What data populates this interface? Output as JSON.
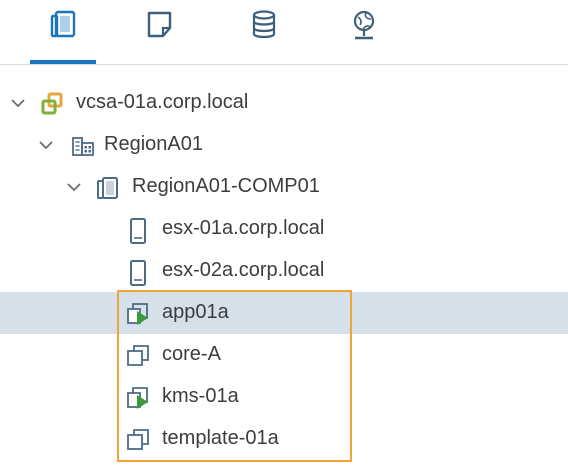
{
  "tabs": [
    {
      "name": "hosts-and-clusters",
      "icon": "hosts-clusters-icon",
      "selected": true
    },
    {
      "name": "vms-and-templates",
      "icon": "vm-templates-icon",
      "selected": false
    },
    {
      "name": "storage",
      "icon": "storage-icon",
      "selected": false
    },
    {
      "name": "networking",
      "icon": "network-icon",
      "selected": false
    }
  ],
  "tree": {
    "vcenter": {
      "label": "vcsa-01a.corp.local",
      "icon": "vcenter-icon",
      "expanded": true
    },
    "datacenter": {
      "label": "RegionA01",
      "icon": "datacenter-icon",
      "expanded": true
    },
    "cluster": {
      "label": "RegionA01-COMP01",
      "icon": "cluster-icon",
      "expanded": true
    },
    "hosts": [
      {
        "label": "esx-01a.corp.local",
        "icon": "host-icon"
      },
      {
        "label": "esx-02a.corp.local",
        "icon": "host-icon"
      }
    ],
    "vms": [
      {
        "label": "app01a",
        "icon": "vm-powered-on-icon",
        "selected": true
      },
      {
        "label": "core-A",
        "icon": "vm-icon",
        "selected": false
      },
      {
        "label": "kms-01a",
        "icon": "vm-powered-on-icon",
        "selected": false
      },
      {
        "label": "template-01a",
        "icon": "vm-icon",
        "selected": false
      }
    ]
  },
  "colors": {
    "accent": "#1b75bc",
    "selected_row": "#d6e0e8",
    "highlight_box": "#f0a23b",
    "vcenter_orange": "#e8a33d",
    "vcenter_green": "#7fb23a",
    "power_green": "#3d9a3a"
  }
}
